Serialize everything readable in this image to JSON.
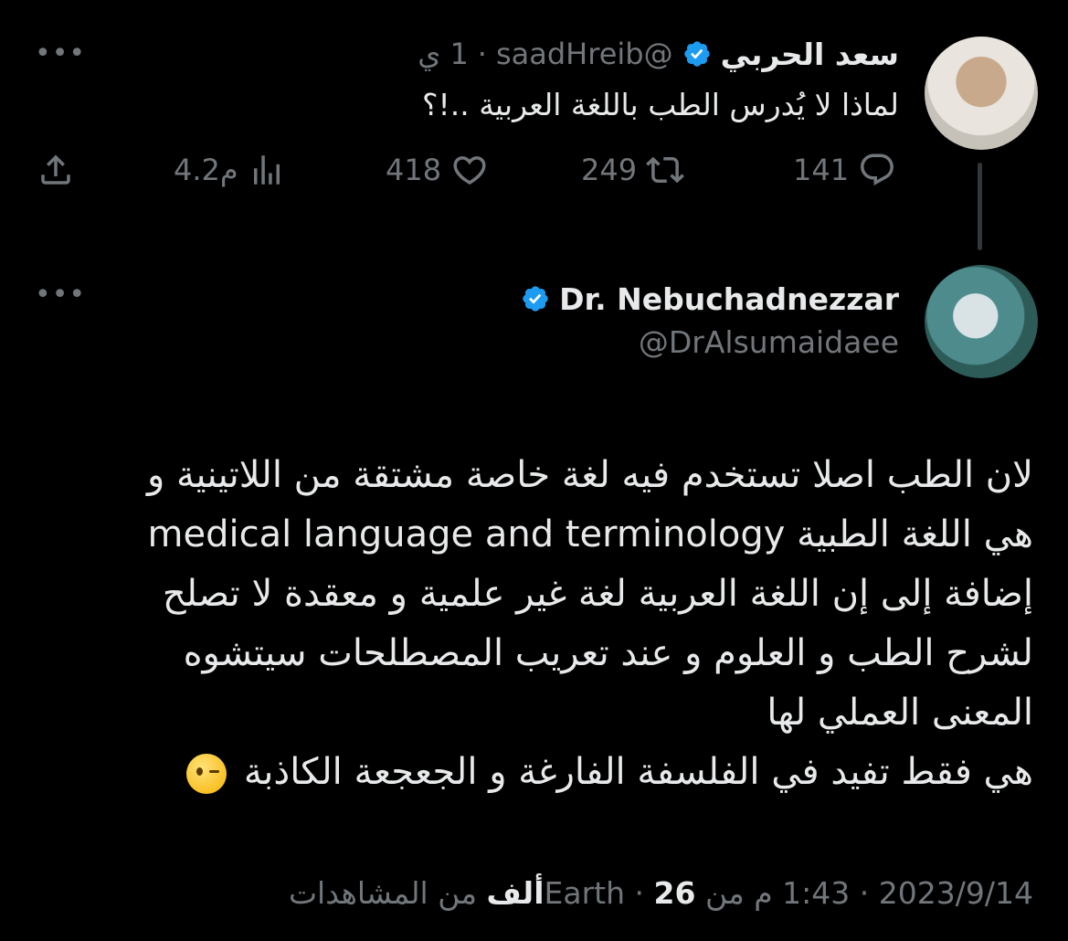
{
  "reply_to": {
    "name": "سعد الحربي",
    "handle": "@saadHreib",
    "separator": "·",
    "time": "1 ي",
    "text": "لماذا لا يُدرس الطب باللغة العربية ..!؟",
    "verified_color": "#1d9bf0",
    "actions": {
      "reply_count": "141",
      "retweet_count": "249",
      "like_count": "418",
      "views_count": "4.2م"
    }
  },
  "tweet": {
    "name": "Dr. Nebuchadnezzar",
    "handle": "@DrAlsumaidaee",
    "lines": [
      "لان الطب اصلا تستخدم فيه لغة خاصة مشتقة من اللاتينية و",
      "هي اللغة الطبية medical language and terminology",
      "إضافة إلى إن اللغة العربية لغة غير علمية و معقدة  لا تصلح",
      "لشرح الطب و العلوم و عند تعريب المصطلحات سيتشوه",
      "المعنى العملي لها",
      "هي فقط تفيد في الفلسفة الفارغة و الجعجعة الكاذبة"
    ],
    "emoji": "winking-face",
    "meta": {
      "date": "2023/9/14",
      "sep1": "·",
      "time": "1:43 م",
      "from": "من Earth",
      "sep2": "·",
      "views_number": "26",
      "views_unit": "ألف",
      "views_label": "من المشاهدات"
    }
  },
  "icons": {
    "more": "more-horizontal-icon",
    "reply": "reply-icon",
    "retweet": "retweet-icon",
    "like": "heart-icon",
    "views": "views-icon",
    "share": "share-icon"
  },
  "colors": {
    "background": "#000000",
    "text": "#e7e9ea",
    "muted": "#71767b",
    "verified": "#1d9bf0"
  }
}
